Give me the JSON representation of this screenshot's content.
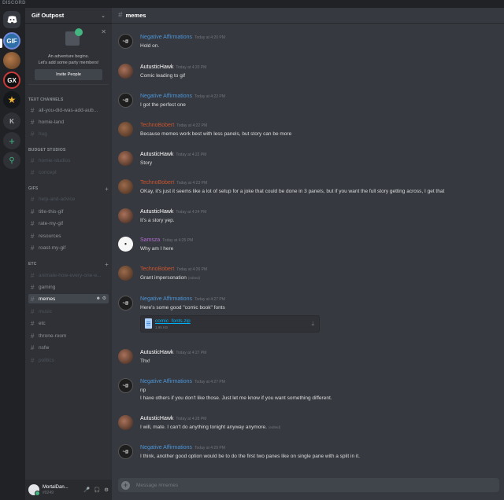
{
  "app": {
    "brand": "DISCORD"
  },
  "guilds": [
    {
      "name": "home",
      "icon": "discord-logo-icon"
    },
    {
      "label": "GIF"
    },
    {
      "label": ""
    },
    {
      "label": "GX"
    },
    {
      "label": "★"
    },
    {
      "label": "K"
    },
    {
      "label": "+"
    },
    {
      "label": "⚲"
    }
  ],
  "server": {
    "name": "Gif Outpost",
    "invite": {
      "line1": "An adventure begins.",
      "line2": "Let's add some party members!",
      "button": "Invite People"
    },
    "categories": [
      {
        "name": "TEXT CHANNELS",
        "channels": [
          {
            "name": "all-you-did-was-add-aub..."
          },
          {
            "name": "homie-land"
          },
          {
            "name": "hug"
          }
        ]
      },
      {
        "name": "BUDGET STUDIOS",
        "channels": [
          {
            "name": "homie-studios"
          },
          {
            "name": "concept"
          }
        ]
      },
      {
        "name": "GIFS",
        "channels": [
          {
            "name": "help-and-advice"
          },
          {
            "name": "title-this-gif"
          },
          {
            "name": "rate-my-gif"
          },
          {
            "name": "resources"
          },
          {
            "name": "roast-my-gif"
          }
        ]
      },
      {
        "name": "ETC",
        "channels": [
          {
            "name": "animate-how-every-one-e..."
          },
          {
            "name": "gaming"
          },
          {
            "name": "memes"
          },
          {
            "name": "music"
          },
          {
            "name": "etc"
          },
          {
            "name": "throne-room"
          },
          {
            "name": "nsfw"
          },
          {
            "name": "politics"
          }
        ]
      }
    ]
  },
  "user": {
    "name": "MortalDan...",
    "tag": "#0249"
  },
  "chat": {
    "channel": "memes",
    "composer_placeholder": "Message #memes",
    "attachment": {
      "name": "comic_fonts.zip",
      "size": "1.95 KB"
    },
    "messages": [
      {
        "author": "Negative Affirmations",
        "color": "#4d94d6",
        "time": "Today at 4:20 PM",
        "lines": [
          "Hold on."
        ]
      },
      {
        "author": "AutusticHawk",
        "color": "#ffffff",
        "time": "Today at 4:20 PM",
        "lines": [
          "Comic leading to gif"
        ]
      },
      {
        "author": "Negative Affirmations",
        "color": "#4d94d6",
        "time": "Today at 4:22 PM",
        "lines": [
          "I got the perfect one"
        ]
      },
      {
        "author": "TechnoBobert",
        "color": "#c9542f",
        "time": "Today at 4:22 PM",
        "lines": [
          "Because memes work best with less panels, but story can be more"
        ]
      },
      {
        "author": "AutusticHawk",
        "color": "#ffffff",
        "time": "Today at 4:22 PM",
        "lines": [
          "Story"
        ]
      },
      {
        "author": "TechnoBobert",
        "color": "#c9542f",
        "time": "Today at 4:23 PM",
        "lines": [
          "OKay, it's just it seems like a lot of setup for a joke that could be done in 3 panels, but if you want the full story getting across, I get that"
        ]
      },
      {
        "author": "AutusticHawk",
        "color": "#ffffff",
        "time": "Today at 4:24 PM",
        "lines": [
          "It's a story yep."
        ]
      },
      {
        "author": "Samsza",
        "color": "#b36ad1",
        "time": "Today at 4:25 PM",
        "lines": [
          "Why am I here"
        ]
      },
      {
        "author": "TechnoBobert",
        "color": "#c9542f",
        "time": "Today at 4:26 PM",
        "lines": [
          "Grant impersonation"
        ],
        "edited": "(edited)"
      },
      {
        "author": "Negative Affirmations",
        "color": "#4d94d6",
        "time": "Today at 4:27 PM",
        "lines": [
          "Here's some good \"comic book\" fonts"
        ]
      },
      {
        "author": "AutusticHawk",
        "color": "#ffffff",
        "time": "Today at 4:27 PM",
        "lines": [
          "Thx!"
        ]
      },
      {
        "author": "Negative Affirmations",
        "color": "#4d94d6",
        "time": "Today at 4:27 PM",
        "lines": [
          "np",
          "I have others if you don't like those. Just let me know if you want something different."
        ]
      },
      {
        "author": "AutusticHawk",
        "color": "#ffffff",
        "time": "Today at 4:28 PM",
        "lines": [
          "I will, mate. I can't do anything tonight anyway anymore."
        ],
        "edited": "(edited)"
      },
      {
        "author": "Negative Affirmations",
        "color": "#4d94d6",
        "time": "Today at 4:29 PM",
        "lines": [
          "I think, another good option would be to do the first two panes like on single pane with a split in it."
        ]
      }
    ]
  }
}
